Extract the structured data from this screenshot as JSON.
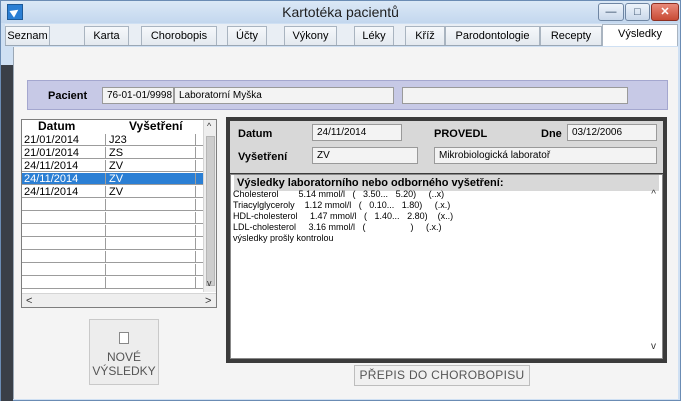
{
  "window": {
    "title": "Kartotéka pacientů",
    "controls": {
      "minimize": "—",
      "maximize": "□",
      "close": "✕"
    }
  },
  "tabs": [
    {
      "label": "Seznam"
    },
    {
      "label": "Karta"
    },
    {
      "label": "Chorobopis"
    },
    {
      "label": "Účty"
    },
    {
      "label": "Výkony"
    },
    {
      "label": "Léky"
    },
    {
      "label": "Kříž"
    },
    {
      "label": "Parodontologie"
    },
    {
      "label": "Recepty"
    },
    {
      "label": "Výsledky",
      "active": true
    }
  ],
  "patient": {
    "label": "Pacient",
    "birth_number": "76-01-01/9998",
    "name": "Laboratorní Myška",
    "extra": ""
  },
  "grid": {
    "col_date": "Datum",
    "col_exam": "Vyšetření",
    "rows": [
      {
        "date": "21/01/2014",
        "exam": "J23",
        "selected": false
      },
      {
        "date": "21/01/2014",
        "exam": "ZS",
        "selected": false
      },
      {
        "date": "24/11/2014",
        "exam": "ZV",
        "selected": false
      },
      {
        "date": "24/11/2014",
        "exam": "ZV",
        "selected": true
      },
      {
        "date": "24/11/2014",
        "exam": "ZV",
        "selected": false
      },
      {
        "date": "",
        "exam": "",
        "selected": false
      },
      {
        "date": "",
        "exam": "",
        "selected": false
      },
      {
        "date": "",
        "exam": "",
        "selected": false
      },
      {
        "date": "",
        "exam": "",
        "selected": false
      },
      {
        "date": "",
        "exam": "",
        "selected": false
      },
      {
        "date": "",
        "exam": "",
        "selected": false
      },
      {
        "date": "",
        "exam": "",
        "selected": false
      },
      {
        "date": "",
        "exam": "",
        "selected": false
      }
    ],
    "scroll_left": "<",
    "scroll_right": ">",
    "scroll_up": "^",
    "scroll_down": "v"
  },
  "new_results_button": {
    "line1": "NOVÉ",
    "line2": "VÝSLEDKY"
  },
  "detail": {
    "date_label": "Datum",
    "date_value": "24/11/2014",
    "performed_label": "PROVEDL",
    "day_label": "Dne",
    "day_value": "03/12/2006",
    "exam_label": "Vyšetření",
    "exam_value": "ZV",
    "lab_value": "Mikrobiologická laboratoř",
    "results_title": "Výsledky laboratorního nebo odborného vyšetření:",
    "results_lines": [
      "Cholesterol        5.14 mmol/l   (   3.50...   5.20)     (..x)",
      "Triacylglyceroly    1.12 mmol/l   (   0.10...   1.80)     (.x.)",
      "HDL-cholesterol     1.47 mmol/l   (   1.40...   2.80)    (x..)",
      "LDL-cholesterol     3.16 mmol/l   (                  )     (.x.)",
      "výsledky prošly kontrolou"
    ],
    "scroll_up": "^",
    "scroll_down": "v"
  },
  "rewrite_button": "PŘEPIS DO CHOROBOPISU",
  "colors": {
    "accent": "#2b7fd4",
    "patient_bar": "#c7c9e6",
    "panel_frame": "#3b3b3b"
  }
}
